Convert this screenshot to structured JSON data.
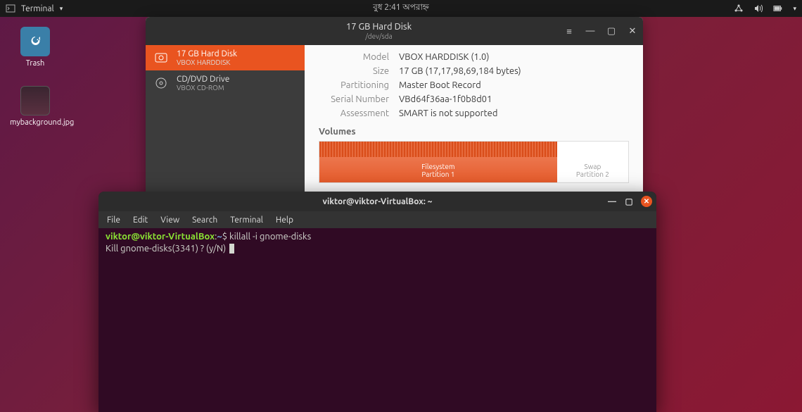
{
  "panel": {
    "app": "Terminal",
    "clock": "বুধ  2:41 অপরাহ্ন"
  },
  "desktop": {
    "trash": "Trash",
    "img_name": "mybackground.jpg"
  },
  "disks": {
    "title": "17 GB Hard Disk",
    "subtitle": "/dev/sda",
    "sidebar": [
      {
        "line1": "17 GB Hard Disk",
        "line2": "VBOX HARDDISK"
      },
      {
        "line1": "CD/DVD Drive",
        "line2": "VBOX CD-ROM"
      }
    ],
    "info": {
      "model_label": "Model",
      "model_value": "VBOX HARDDISK (1.0)",
      "size_label": "Size",
      "size_value": "17 GB (17,17,98,69,184 bytes)",
      "part_label": "Partitioning",
      "part_value": "Master Boot Record",
      "serial_label": "Serial Number",
      "serial_value": "VBd64f36aa-1f0b8d01",
      "assess_label": "Assessment",
      "assess_value": "SMART is not supported"
    },
    "volumes_title": "Volumes",
    "vol1_line1": "Filesystem",
    "vol1_line2": "Partition 1",
    "vol2_line1": "Swap",
    "vol2_line2": "Partition 2"
  },
  "terminal": {
    "title": "viktor@viktor-VirtualBox: ~",
    "menu": {
      "file": "File",
      "edit": "Edit",
      "view": "View",
      "search": "Search",
      "terminal": "Terminal",
      "help": "Help"
    },
    "prompt_user": "viktor@viktor-VirtualBox",
    "prompt_sep": ":",
    "prompt_path": "~",
    "prompt_dollar": "$",
    "command": " killall -i gnome-disks",
    "output": "Kill gnome-disks(3341) ? (y/N) "
  }
}
